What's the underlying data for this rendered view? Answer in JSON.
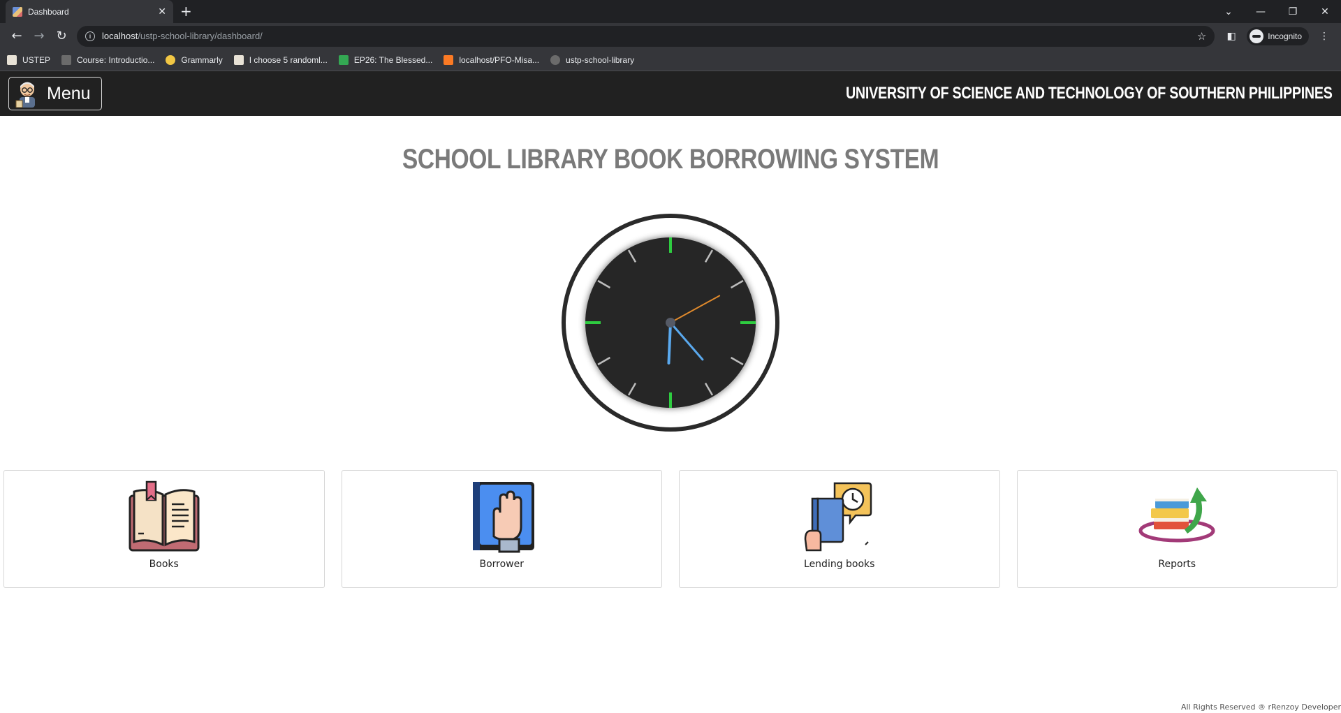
{
  "browser": {
    "tab_title": "Dashboard",
    "tab_close": "✕",
    "new_tab": "+",
    "url_host": "localhost",
    "url_path": "/ustp-school-library/dashboard/",
    "incognito_label": "Incognito",
    "bookmarks": [
      {
        "label": "USTEP",
        "icon": "doc-icon",
        "color": "#e8e2d6"
      },
      {
        "label": "Course: Introductio...",
        "icon": "course-icon",
        "color": "#6b6b6b"
      },
      {
        "label": "Grammarly",
        "icon": "grammarly-icon",
        "color": "#f2c744"
      },
      {
        "label": "I choose 5 randoml...",
        "icon": "doc-icon",
        "color": "#e8e2d6"
      },
      {
        "label": "EP26: The Blessed...",
        "icon": "play-icon",
        "color": "#34a853"
      },
      {
        "label": "localhost/PFO-Misa...",
        "icon": "xampp-icon",
        "color": "#fb7a24"
      },
      {
        "label": "ustp-school-library",
        "icon": "globe-icon",
        "color": "#6b6b6b"
      }
    ]
  },
  "header": {
    "menu_label": "Menu",
    "university": "UNIVERSITY OF SCIENCE AND TECHNOLOGY OF SOUTHERN PHILIPPINES"
  },
  "main": {
    "title": "SCHOOL LIBRARY BOOK BORROWING SYSTEM",
    "clock": {
      "hour": 5.75,
      "minute": 22.5,
      "second": 10.2,
      "accent": "#2ecc40",
      "hand_color": "#5aa9ee",
      "second_color": "#e08a2c"
    },
    "cards": [
      {
        "label": "Books",
        "icon": "open-book-icon"
      },
      {
        "label": "Borrower",
        "icon": "raised-hand-book-icon"
      },
      {
        "label": "Lending books",
        "icon": "book-clock-icon"
      },
      {
        "label": "Reports",
        "icon": "books-arrow-icon"
      }
    ]
  },
  "footer": {
    "text": "All Rights Reserved ® rRenzoy Developer"
  }
}
